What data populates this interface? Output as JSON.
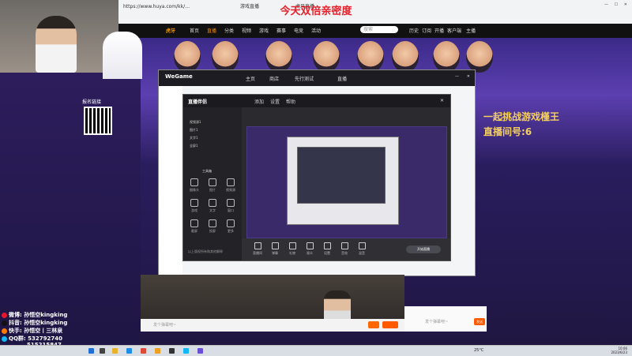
{
  "overlay": {
    "title": "今天双倍亲密度"
  },
  "browser": {
    "tabs": [
      {
        "label": "https://www.huya.com/kk/…",
        "active": false
      },
      {
        "label": "游戏直播",
        "active": false
      },
      {
        "label": "虎牙直播",
        "active": true
      }
    ],
    "title_label": "虎牙直播"
  },
  "site_nav": {
    "items": [
      "首页",
      "直播",
      "分类",
      "视频",
      "游戏",
      "赛事",
      "电竞",
      "活动"
    ],
    "search_placeholder": "搜索",
    "right_items": [
      "历史",
      "订阅",
      "开播",
      "客户端",
      "主播"
    ]
  },
  "banner": {
    "headline": "一起挑战游戏槿王",
    "room_text": "直播间号:6"
  },
  "streamer_panel": {
    "qr_label": "报名链接",
    "socials": [
      {
        "platform": "微博",
        "handle": "孙悟空kingking",
        "color": "#e6162d"
      },
      {
        "platform": "抖音",
        "handle": "孙悟空kingking",
        "color": "#111111"
      },
      {
        "platform": "快手",
        "handle": "孙悟空丨三林泉",
        "color": "#ff7a00"
      },
      {
        "platform": "QQ群",
        "handle": "532792740",
        "color": "#12b7f5"
      },
      {
        "platform": "",
        "handle": "515215847",
        "color": "#12b7f5"
      }
    ]
  },
  "wegame": {
    "logo": "WeGame",
    "tabs": [
      "主页",
      "商店",
      "先行测试",
      "直播"
    ],
    "tool": {
      "title": "直播伴侣",
      "menu": [
        "添加",
        "设置",
        "帮助"
      ],
      "side_items": [
        "视频源1",
        "图片1",
        "文字1",
        "全屏1"
      ],
      "grid_label": "工具箱",
      "grid": [
        "摄像头",
        "图片",
        "视频源",
        "游戏",
        "文字",
        "窗口",
        "截屏",
        "投屏",
        "更多"
      ],
      "bottom_buttons": [
        "直播间",
        "弹幕",
        "礼物",
        "观众",
        "设置",
        "音效",
        "混音"
      ],
      "footer_text": "以上版权所有和其他解释",
      "start_label": "开始直播"
    }
  },
  "bottom_bar": {
    "input_placeholder": "发个弹幕吧~",
    "send_label": "发送"
  },
  "taskbar": {
    "weather": "25°C",
    "time": "10:06",
    "date": "2023/6/23",
    "icons": [
      {
        "name": "start-icon",
        "color": "#1f6fd6"
      },
      {
        "name": "search-icon",
        "color": "#444444"
      },
      {
        "name": "file-explorer-icon",
        "color": "#e8b32b"
      },
      {
        "name": "edge-icon",
        "color": "#1d8ee8"
      },
      {
        "name": "chrome-icon",
        "color": "#dd4b39"
      },
      {
        "name": "wegame-icon",
        "color": "#f0a020"
      },
      {
        "name": "obs-icon",
        "color": "#333333"
      },
      {
        "name": "qq-icon",
        "color": "#12b7f5"
      },
      {
        "name": "app-icon",
        "color": "#6a4fd6"
      }
    ]
  }
}
